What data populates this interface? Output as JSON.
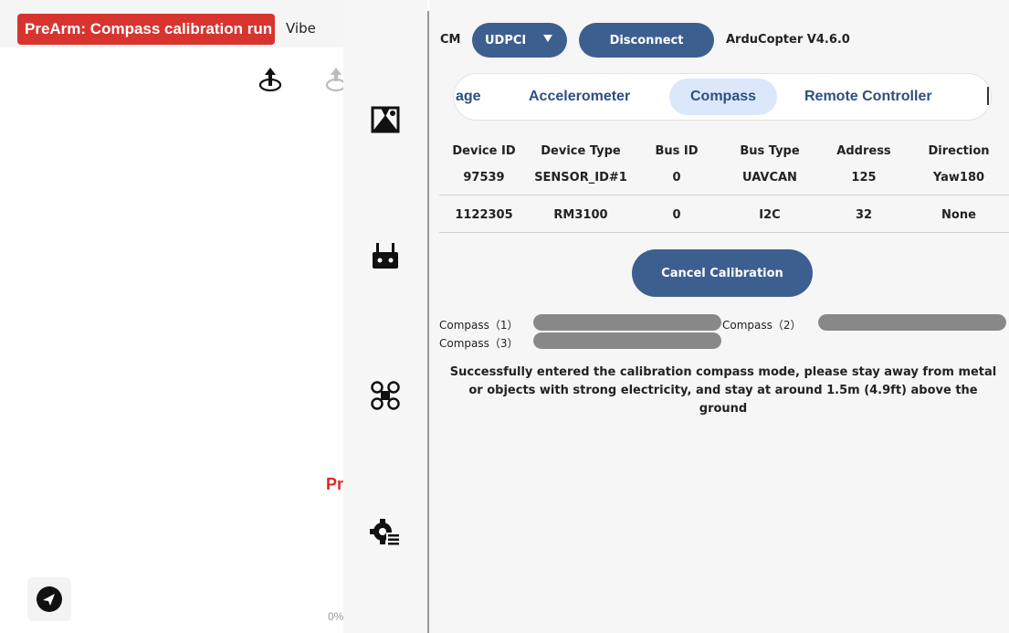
{
  "map": {
    "prearm_text": "PreArm: Compass calibration run",
    "vibe_label": "Vibe",
    "pr_text": "Pr",
    "progress_text": "0%"
  },
  "rail": {
    "icons": [
      "vehicle-setup-icon",
      "remote-controller-icon",
      "drone-frame-icon",
      "settings-icon"
    ]
  },
  "toolbar": {
    "cm_label": "CM",
    "connection_type": "UDPCI",
    "disconnect_label": "Disconnect",
    "firmware": "ArduCopter V4.6.0"
  },
  "tabs": [
    {
      "label": "age"
    },
    {
      "label": "Accelerometer"
    },
    {
      "label": "Compass",
      "active": true
    },
    {
      "label": "Remote Controller"
    }
  ],
  "compass_table": {
    "headers": [
      "Device ID",
      "Device Type",
      "Bus ID",
      "Bus Type",
      "Address",
      "Direction"
    ],
    "rows": [
      [
        "97539",
        "SENSOR_ID#1",
        "0",
        "UAVCAN",
        "125",
        "Yaw180"
      ],
      [
        "1122305",
        "RM3100",
        "0",
        "I2C",
        "32",
        "None"
      ]
    ]
  },
  "cancel_label": "Cancel Calibration",
  "progress": [
    {
      "label": "Compass（1）",
      "fraction": 1.0
    },
    {
      "label": "Compass（2）",
      "fraction": 1.0
    },
    {
      "label": "Compass（3）",
      "fraction": 1.0
    }
  ],
  "message": "Successfully entered the calibration compass mode, please stay away from metal or objects with strong electricity, and stay at around 1.5m (4.9ft) above the ground",
  "colors": {
    "prearm_bg": "#d8342f",
    "primary_button": "#3d5f8f",
    "active_tab_bg": "#dbe8fb",
    "progress_fill": "#888888",
    "warning_text": "#e0281f"
  }
}
